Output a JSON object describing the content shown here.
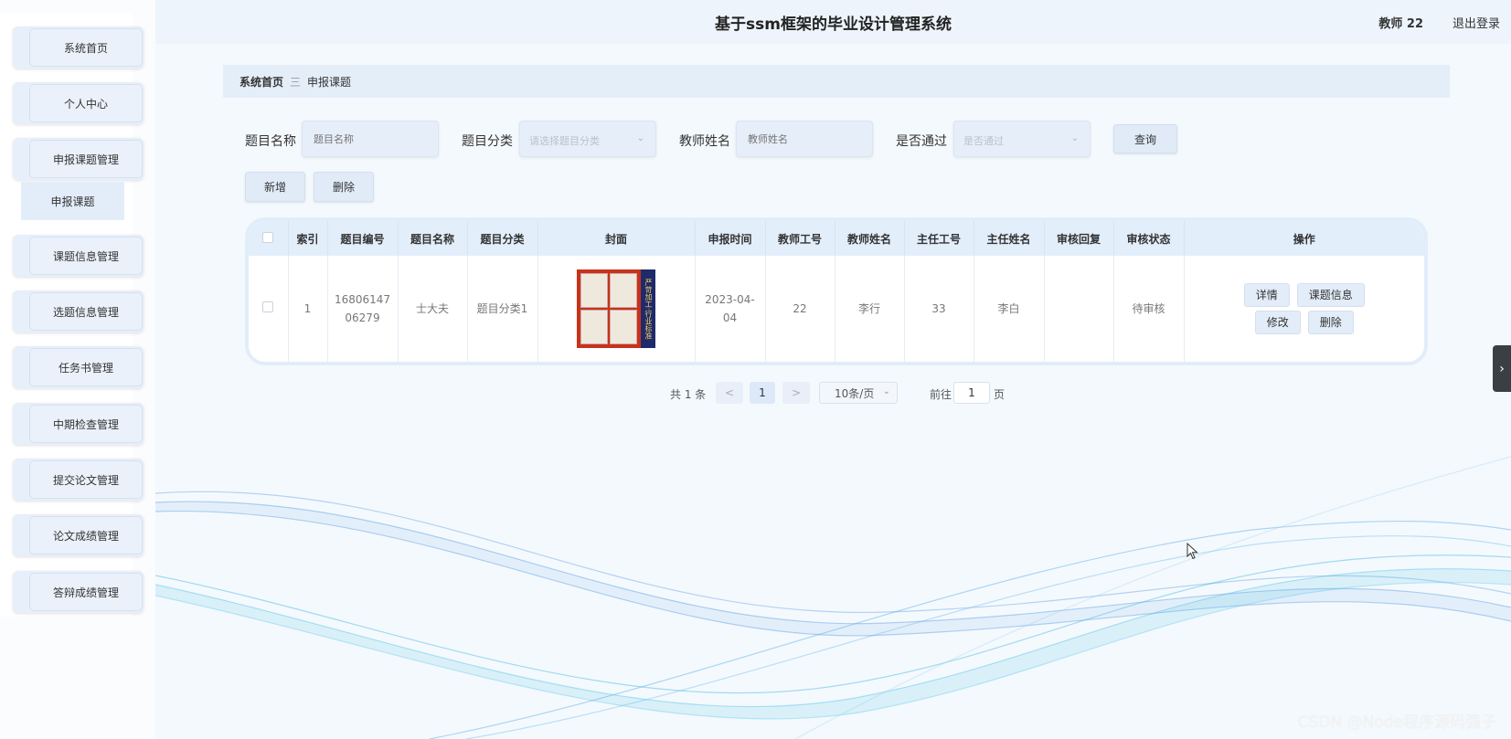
{
  "header": {
    "title": "基于ssm框架的毕业设计管理系统",
    "user": "教师 22",
    "logout": "退出登录"
  },
  "sidebar": {
    "items": [
      {
        "label": "系统首页"
      },
      {
        "label": "个人中心"
      },
      {
        "label": "申报课题管理"
      },
      {
        "label": "课题信息管理"
      },
      {
        "label": "选题信息管理"
      },
      {
        "label": "任务书管理"
      },
      {
        "label": "中期检查管理"
      },
      {
        "label": "提交论文管理"
      },
      {
        "label": "论文成绩管理"
      },
      {
        "label": "答辩成绩管理"
      }
    ],
    "submenu": {
      "label": "申报课题"
    }
  },
  "breadcrumb": {
    "home": "系统首页",
    "separator": "三",
    "current": "申报课题"
  },
  "search": {
    "title_label": "题目名称",
    "title_placeholder": "题目名称",
    "category_label": "题目分类",
    "category_placeholder": "请选择题目分类",
    "teacher_label": "教师姓名",
    "teacher_placeholder": "教师姓名",
    "passed_label": "是否通过",
    "passed_placeholder": "是否通过",
    "query_button": "查询"
  },
  "actions": {
    "add": "新增",
    "delete": "删除"
  },
  "table": {
    "headers": [
      "索引",
      "题目编号",
      "题目名称",
      "题目分类",
      "封面",
      "申报时间",
      "教师工号",
      "教师姓名",
      "主任工号",
      "主任姓名",
      "审核回复",
      "审核状态",
      "操作"
    ],
    "rows": [
      {
        "index": "1",
        "code_line1": "16806147",
        "code_line2": "06279",
        "name": "士大夫",
        "category": "题目分类1",
        "cover_text": "严苛加工·行业标准",
        "date_line1": "2023-04-",
        "date_line2": "04",
        "teacher_id": "22",
        "teacher_name": "李行",
        "director_id": "33",
        "director_name": "李白",
        "reply": "",
        "status": "待审核",
        "ops": {
          "detail": "详情",
          "topic_info": "课题信息",
          "edit": "修改",
          "delete": "删除"
        }
      }
    ]
  },
  "pagination": {
    "total": "共 1 条",
    "prev": "<",
    "page": "1",
    "next": ">",
    "page_size": "10条/页",
    "goto_label": "前往",
    "goto_value": "1",
    "goto_suffix": "页"
  },
  "watermark": "CSDN @Node程序源码强子",
  "colors": {
    "accent": "#e3eefb",
    "background": "#f4f9fd",
    "sidebar_item": "#e6effa"
  }
}
